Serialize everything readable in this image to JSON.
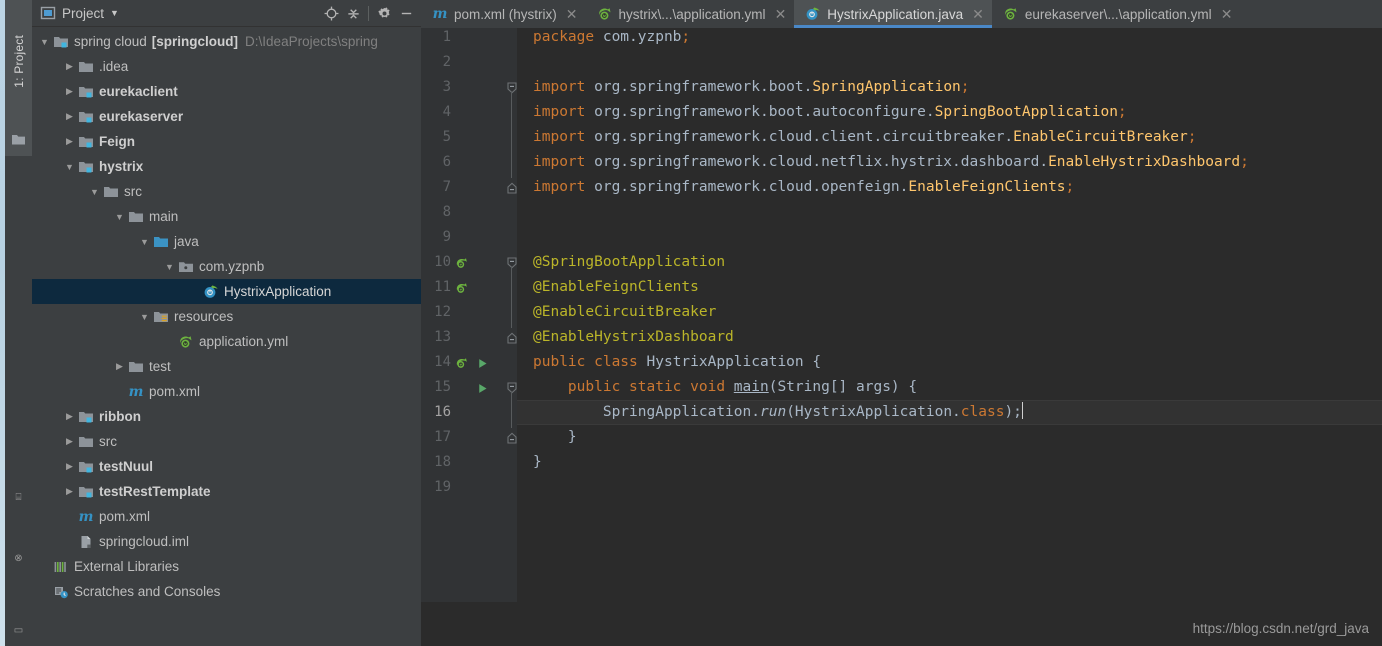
{
  "window": {
    "tool_tab_label": "1: Project",
    "watermark": "https://blog.csdn.net/grd_java"
  },
  "project_panel": {
    "title": "Project",
    "icons": {
      "panel": "project-panel-icon",
      "caret": "chevron-down-icon",
      "locate": "locate-target-icon",
      "collapse": "collapse-all-icon",
      "settings": "gear-icon",
      "hide": "minimize-icon"
    },
    "tree": [
      {
        "label": "spring cloud",
        "bold_label": "[springcloud]",
        "path": "D:\\IdeaProjects\\spring",
        "indent": 0,
        "arrow": "down",
        "icon": "module-folder-icon",
        "selected": false
      },
      {
        "label": ".idea",
        "indent": 1,
        "arrow": "right",
        "icon": "folder-icon",
        "selected": false
      },
      {
        "label": "eurekaclient",
        "indent": 1,
        "arrow": "right",
        "icon": "module-folder-icon",
        "bold": true,
        "selected": false
      },
      {
        "label": "eurekaserver",
        "indent": 1,
        "arrow": "right",
        "icon": "module-folder-icon",
        "bold": true,
        "selected": false
      },
      {
        "label": "Feign",
        "indent": 1,
        "arrow": "right",
        "icon": "module-folder-icon",
        "bold": true,
        "selected": false
      },
      {
        "label": "hystrix",
        "indent": 1,
        "arrow": "down",
        "icon": "module-folder-icon",
        "bold": true,
        "selected": false
      },
      {
        "label": "src",
        "indent": 2,
        "arrow": "down",
        "icon": "folder-icon",
        "selected": false
      },
      {
        "label": "main",
        "indent": 3,
        "arrow": "down",
        "icon": "folder-icon",
        "selected": false
      },
      {
        "label": "java",
        "indent": 4,
        "arrow": "down",
        "icon": "source-root-folder-icon",
        "selected": false
      },
      {
        "label": "com.yzpnb",
        "indent": 5,
        "arrow": "down",
        "icon": "package-icon",
        "selected": false
      },
      {
        "label": "HystrixApplication",
        "indent": 6,
        "arrow": "none",
        "icon": "java-class-spring-icon",
        "selected": true
      },
      {
        "label": "resources",
        "indent": 4,
        "arrow": "down",
        "icon": "resource-root-folder-icon",
        "selected": false
      },
      {
        "label": "application.yml",
        "indent": 5,
        "arrow": "none",
        "icon": "spring-yml-icon",
        "selected": false
      },
      {
        "label": "test",
        "indent": 3,
        "arrow": "right",
        "icon": "folder-icon",
        "selected": false
      },
      {
        "label": "pom.xml",
        "indent": 3,
        "arrow": "none",
        "icon": "maven-icon",
        "selected": false
      },
      {
        "label": "ribbon",
        "indent": 1,
        "arrow": "right",
        "icon": "module-folder-icon",
        "bold": true,
        "selected": false
      },
      {
        "label": "src",
        "indent": 1,
        "arrow": "right",
        "icon": "folder-icon",
        "selected": false
      },
      {
        "label": "testNuul",
        "indent": 1,
        "arrow": "right",
        "icon": "module-folder-icon",
        "bold": true,
        "selected": false
      },
      {
        "label": "testRestTemplate",
        "indent": 1,
        "arrow": "right",
        "icon": "module-folder-icon",
        "bold": true,
        "selected": false
      },
      {
        "label": "pom.xml",
        "indent": 1,
        "arrow": "none",
        "icon": "maven-icon",
        "selected": false
      },
      {
        "label": "springcloud.iml",
        "indent": 1,
        "arrow": "none",
        "icon": "iml-icon",
        "selected": false
      },
      {
        "label": "External Libraries",
        "indent": 0,
        "arrow": "none",
        "icon": "libraries-icon",
        "selected": false
      },
      {
        "label": "Scratches and Consoles",
        "indent": 0,
        "arrow": "none",
        "icon": "scratches-icon",
        "selected": false
      }
    ]
  },
  "editor": {
    "tabs": [
      {
        "label": "pom.xml (hystrix)",
        "icon": "maven-icon",
        "active": false,
        "closable": true
      },
      {
        "label": "hystrix\\...\\application.yml",
        "icon": "spring-yml-icon",
        "active": false,
        "closable": true
      },
      {
        "label": "HystrixApplication.java",
        "icon": "java-class-spring-icon",
        "active": true,
        "closable": true
      },
      {
        "label": "eurekaserver\\...\\application.yml",
        "icon": "spring-yml-icon",
        "active": false,
        "closable": true
      }
    ],
    "active_tab_accent": "#4a88c7",
    "current_line": 16,
    "line_numbers": [
      1,
      2,
      3,
      4,
      5,
      6,
      7,
      8,
      9,
      10,
      11,
      12,
      13,
      14,
      15,
      16,
      17,
      18,
      19
    ],
    "gutter_marks": [
      {
        "line": 10,
        "icon": "spring-bean-icon"
      },
      {
        "line": 11,
        "icon": "spring-bean-icon"
      },
      {
        "line": 14,
        "icon": "spring-bean-icon"
      },
      {
        "line": 14,
        "icon": "run-arrow-icon"
      },
      {
        "line": 15,
        "icon": "run-arrow-icon"
      }
    ],
    "fold_marks": [
      {
        "line": 3,
        "type": "fold-open"
      },
      {
        "line": 7,
        "type": "fold-end"
      },
      {
        "line": 10,
        "type": "fold-open"
      },
      {
        "line": 13,
        "type": "fold-end"
      },
      {
        "line": 15,
        "type": "fold-open"
      },
      {
        "line": 17,
        "type": "fold-end"
      }
    ],
    "code": [
      {
        "line": 1,
        "text": "package com.yzpnb;"
      },
      {
        "line": 2,
        "text": ""
      },
      {
        "line": 3,
        "text": "import org.springframework.boot.SpringApplication;"
      },
      {
        "line": 4,
        "text": "import org.springframework.boot.autoconfigure.SpringBootApplication;"
      },
      {
        "line": 5,
        "text": "import org.springframework.cloud.client.circuitbreaker.EnableCircuitBreaker;"
      },
      {
        "line": 6,
        "text": "import org.springframework.cloud.netflix.hystrix.dashboard.EnableHystrixDashboard;"
      },
      {
        "line": 7,
        "text": "import org.springframework.cloud.openfeign.EnableFeignClients;"
      },
      {
        "line": 8,
        "text": ""
      },
      {
        "line": 9,
        "text": ""
      },
      {
        "line": 10,
        "text": "@SpringBootApplication"
      },
      {
        "line": 11,
        "text": "@EnableFeignClients"
      },
      {
        "line": 12,
        "text": "@EnableCircuitBreaker"
      },
      {
        "line": 13,
        "text": "@EnableHystrixDashboard"
      },
      {
        "line": 14,
        "text": "public class HystrixApplication {"
      },
      {
        "line": 15,
        "text": "    public static void main(String[] args) {"
      },
      {
        "line": 16,
        "text": "        SpringApplication.run(HystrixApplication.class);"
      },
      {
        "line": 17,
        "text": "    }"
      },
      {
        "line": 18,
        "text": "}"
      },
      {
        "line": 19,
        "text": ""
      }
    ]
  }
}
